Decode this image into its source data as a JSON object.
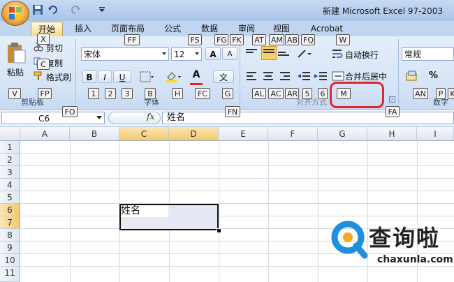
{
  "window": {
    "title": "新建 Microsoft Excel 97-2003"
  },
  "tabs": [
    {
      "label": "开始",
      "active": true
    },
    {
      "label": "插入"
    },
    {
      "label": "页面布局"
    },
    {
      "label": "公式"
    },
    {
      "label": "数据"
    },
    {
      "label": "审阅"
    },
    {
      "label": "视图"
    },
    {
      "label": "Acrobat"
    }
  ],
  "clipboard": {
    "paste_label": "粘贴",
    "cut_label": "剪切",
    "copy_label": "复制",
    "format_painter_label": "格式刷",
    "group_label": "剪贴板"
  },
  "font": {
    "name": "宋体",
    "size": "12",
    "bold": "B",
    "italic": "I",
    "underline": "U",
    "grow": "A",
    "shrink": "A",
    "font_color_glyph": "A",
    "phonetic_glyph": "文",
    "group_label": "字体"
  },
  "alignment": {
    "wrap_text_label": "自动换行",
    "merge_center_label": "合并后居中",
    "group_label": "对齐方式"
  },
  "number": {
    "format": "常规",
    "percent": "%",
    "group_label": "数字"
  },
  "key_tips": {
    "X": "X",
    "C": "C",
    "V": "V",
    "FP": "FP",
    "FF": "FF",
    "FS": "FS",
    "FG": "FG",
    "FK": "FK",
    "AT": "AT",
    "AM": "AM",
    "AB": "AB",
    "FQ": "FQ",
    "W": "W",
    "1": "1",
    "2": "2",
    "3": "3",
    "B": "B",
    "H": "H",
    "FC": "FC",
    "G": "G",
    "AL": "AL",
    "AC": "AC",
    "AR": "AR",
    "5": "5",
    "6": "6",
    "M": "M",
    "AN": "AN",
    "P": "P",
    "K": "K",
    "FO": "FO",
    "FN": "FN",
    "FA": "FA"
  },
  "formula_bar": {
    "name_box": "C6",
    "fx": "fx",
    "content": "姓名"
  },
  "grid": {
    "columns": [
      "A",
      "B",
      "C",
      "D",
      "E",
      "F",
      "G",
      "H",
      "I"
    ],
    "rows": [
      "1",
      "2",
      "3",
      "4",
      "5",
      "6",
      "7",
      "8",
      "9",
      "10",
      "11"
    ],
    "selected_column_headers": [
      "C",
      "D"
    ],
    "selected_row_headers": [
      "6",
      "7"
    ],
    "active_cell_text": "姓名"
  },
  "watermark": {
    "text": "查询啦",
    "url": "chaxunla.com"
  },
  "colors": {
    "accent": "#f3c86a",
    "highlight_ring": "#e0262e",
    "ribbon": "#d5e3f6"
  }
}
